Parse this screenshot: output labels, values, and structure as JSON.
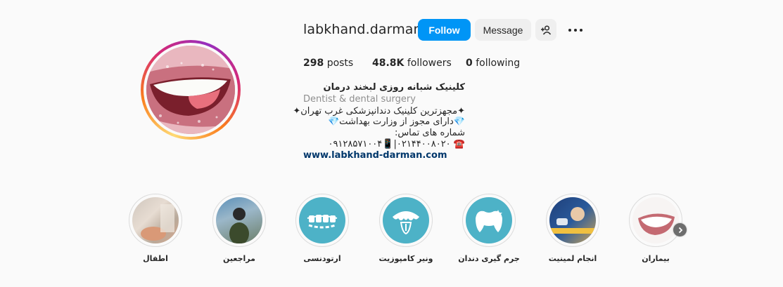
{
  "profile": {
    "username": "labkhand.darman",
    "follow_label": "Follow",
    "message_label": "Message",
    "more_icon": "more-horizontal-icon",
    "add_user_icon": "add-user-icon"
  },
  "stats": {
    "posts_count": "298",
    "posts_label": "posts",
    "followers_count": "48.8K",
    "followers_label": "followers",
    "following_count": "0",
    "following_label": "following"
  },
  "bio": {
    "name": "کلینیک شبانه روزی لبخند درمان",
    "category": "Dentist & dental surgery",
    "line1": "✦مجهزترین کلینیک دندانپزشکی غرب تهران✦",
    "line2": "💎دارای مجوز از وزارت بهداشت💎",
    "line3": "شماره های تماس:",
    "line4": "☎️ ۰۲۱۴۴۰۰۸۰۲۰|📱۰۹۱۲۸۵۷۱۰۰۴",
    "link": "www.labkhand-darman.com"
  },
  "highlights": [
    {
      "label": "اطفال",
      "type": "photo"
    },
    {
      "label": "مراجعین",
      "type": "photo"
    },
    {
      "label": "ارتودنسی",
      "type": "icon",
      "color": "#4db2c7"
    },
    {
      "label": "ونیر کامپوزیت",
      "type": "icon",
      "color": "#4db2c7"
    },
    {
      "label": "جرم گیری دندان",
      "type": "icon",
      "color": "#4db2c7"
    },
    {
      "label": "انجام لمینیت",
      "type": "photo"
    },
    {
      "label": "بیماران",
      "type": "photo"
    }
  ],
  "colors": {
    "follow_button": "#0095f6",
    "highlight_teal": "#4db2c7",
    "link": "#00376b"
  }
}
